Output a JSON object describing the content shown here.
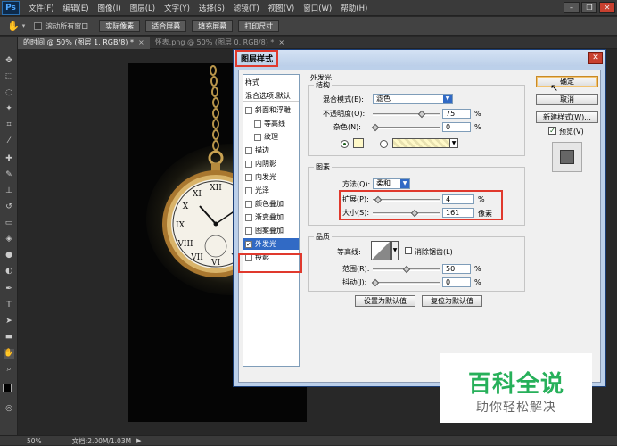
{
  "menu": {
    "logo": "Ps",
    "items": [
      "文件(F)",
      "编辑(E)",
      "图像(I)",
      "图层(L)",
      "文字(Y)",
      "选择(S)",
      "滤镜(T)",
      "视图(V)",
      "窗口(W)",
      "帮助(H)"
    ]
  },
  "options": {
    "scroll_all_label": "滚动所有窗口",
    "buttons": [
      "实际像素",
      "适合屏幕",
      "填充屏幕",
      "打印尺寸"
    ]
  },
  "tabs": [
    {
      "label": "的时间 @ 50% (图层 1, RGB/8) *",
      "active": true
    },
    {
      "label": "怀表.png @ 50% (图层 0, RGB/8) *",
      "active": false
    }
  ],
  "status": {
    "zoom": "50%",
    "doc": "文档:2.00M/1.03M"
  },
  "dialog": {
    "title": "图层样式",
    "style_header": "样式",
    "blend_options": "混合选项:默认",
    "effects": [
      {
        "label": "斜面和浮雕",
        "checked": false,
        "indent": false
      },
      {
        "label": "等高线",
        "checked": false,
        "indent": true
      },
      {
        "label": "纹理",
        "checked": false,
        "indent": true
      },
      {
        "label": "描边",
        "checked": false,
        "indent": false
      },
      {
        "label": "内阴影",
        "checked": false,
        "indent": false
      },
      {
        "label": "内发光",
        "checked": false,
        "indent": false
      },
      {
        "label": "光泽",
        "checked": false,
        "indent": false
      },
      {
        "label": "颜色叠加",
        "checked": false,
        "indent": false
      },
      {
        "label": "渐变叠加",
        "checked": false,
        "indent": false
      },
      {
        "label": "图案叠加",
        "checked": false,
        "indent": false
      },
      {
        "label": "外发光",
        "checked": true,
        "indent": false,
        "selected": true
      },
      {
        "label": "投影",
        "checked": false,
        "indent": false
      }
    ],
    "panel_title": "外发光",
    "structure": {
      "title": "结构",
      "blend_mode_label": "混合模式(E):",
      "blend_mode": "滤色",
      "opacity_label": "不透明度(O):",
      "opacity": "75",
      "noise_label": "杂色(N):",
      "noise": "0",
      "percent": "%",
      "glow_color": "#fff9c8"
    },
    "elements": {
      "title": "图素",
      "method_label": "方法(Q):",
      "method": "柔和",
      "spread_label": "扩展(P):",
      "spread": "4",
      "size_label": "大小(S):",
      "size": "161",
      "size_unit": "像素",
      "percent": "%"
    },
    "quality": {
      "title": "品质",
      "contour_label": "等高线:",
      "anti_alias_label": "消除锯齿(L)",
      "range_label": "范围(R):",
      "range": "50",
      "jitter_label": "抖动(J):",
      "jitter": "0",
      "percent": "%"
    },
    "default_buttons": {
      "set": "设置为默认值",
      "reset": "复位为默认值"
    },
    "buttons": {
      "ok": "确定",
      "cancel": "取消",
      "new_style": "新建样式(W)...",
      "preview": "预览(V)"
    }
  },
  "watermark": {
    "main": "百科全说",
    "sub": "助你轻松解决"
  }
}
